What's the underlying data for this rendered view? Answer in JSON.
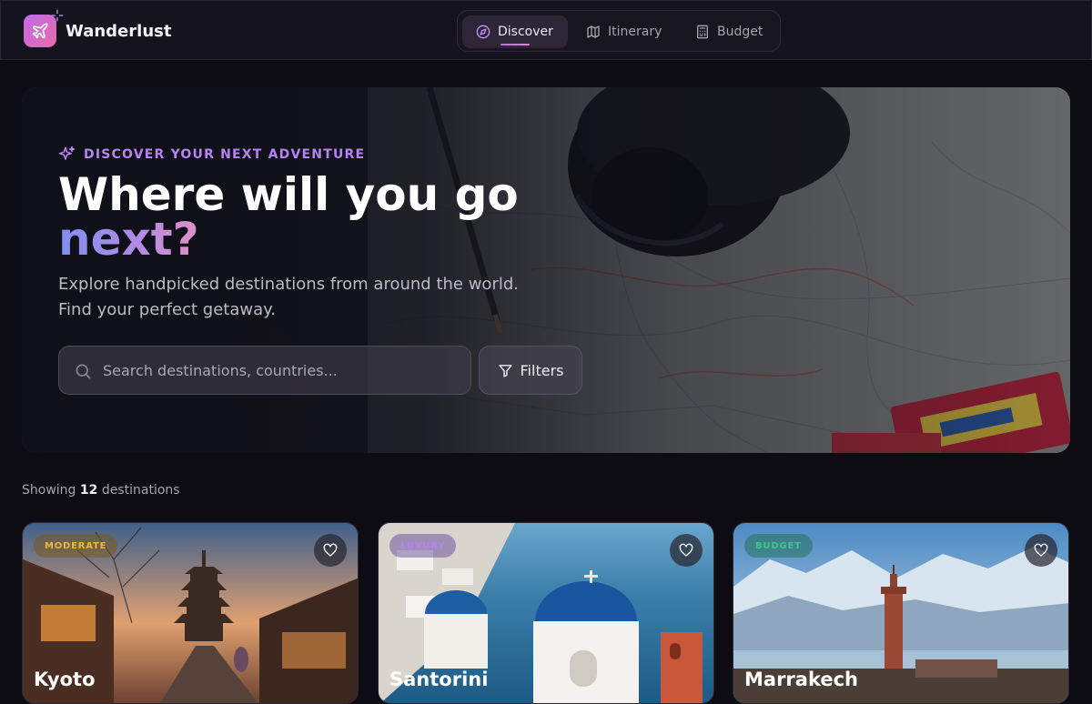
{
  "app": {
    "name": "Wanderlust"
  },
  "nav": {
    "tabs": [
      {
        "label": "Discover",
        "icon": "compass-icon",
        "active": true
      },
      {
        "label": "Itinerary",
        "icon": "map-icon",
        "active": false
      },
      {
        "label": "Budget",
        "icon": "calculator-icon",
        "active": false
      }
    ]
  },
  "hero": {
    "eyebrow": "DISCOVER YOUR NEXT ADVENTURE",
    "title_main": "Where will you go",
    "title_accent": "next?",
    "subtitle_line1": "Explore handpicked destinations from around the world.",
    "subtitle_line2": "Find your perfect getaway.",
    "search_placeholder": "Search destinations, countries...",
    "filters_label": "Filters"
  },
  "results": {
    "prefix": "Showing",
    "count": "12",
    "suffix": "destinations"
  },
  "destinations": [
    {
      "name": "Kyoto",
      "badge": "MODERATE",
      "badge_color": "#f2b63c"
    },
    {
      "name": "Santorini",
      "badge": "LUXURY",
      "badge_color": "#b483f4"
    },
    {
      "name": "Marrakech",
      "badge": "BUDGET",
      "badge_color": "#3cc88a"
    }
  ],
  "colors": {
    "accent": "#b483f4",
    "brand_gradient_start": "#c06bea",
    "brand_gradient_end": "#e86aa8",
    "background": "#0c0c12"
  }
}
